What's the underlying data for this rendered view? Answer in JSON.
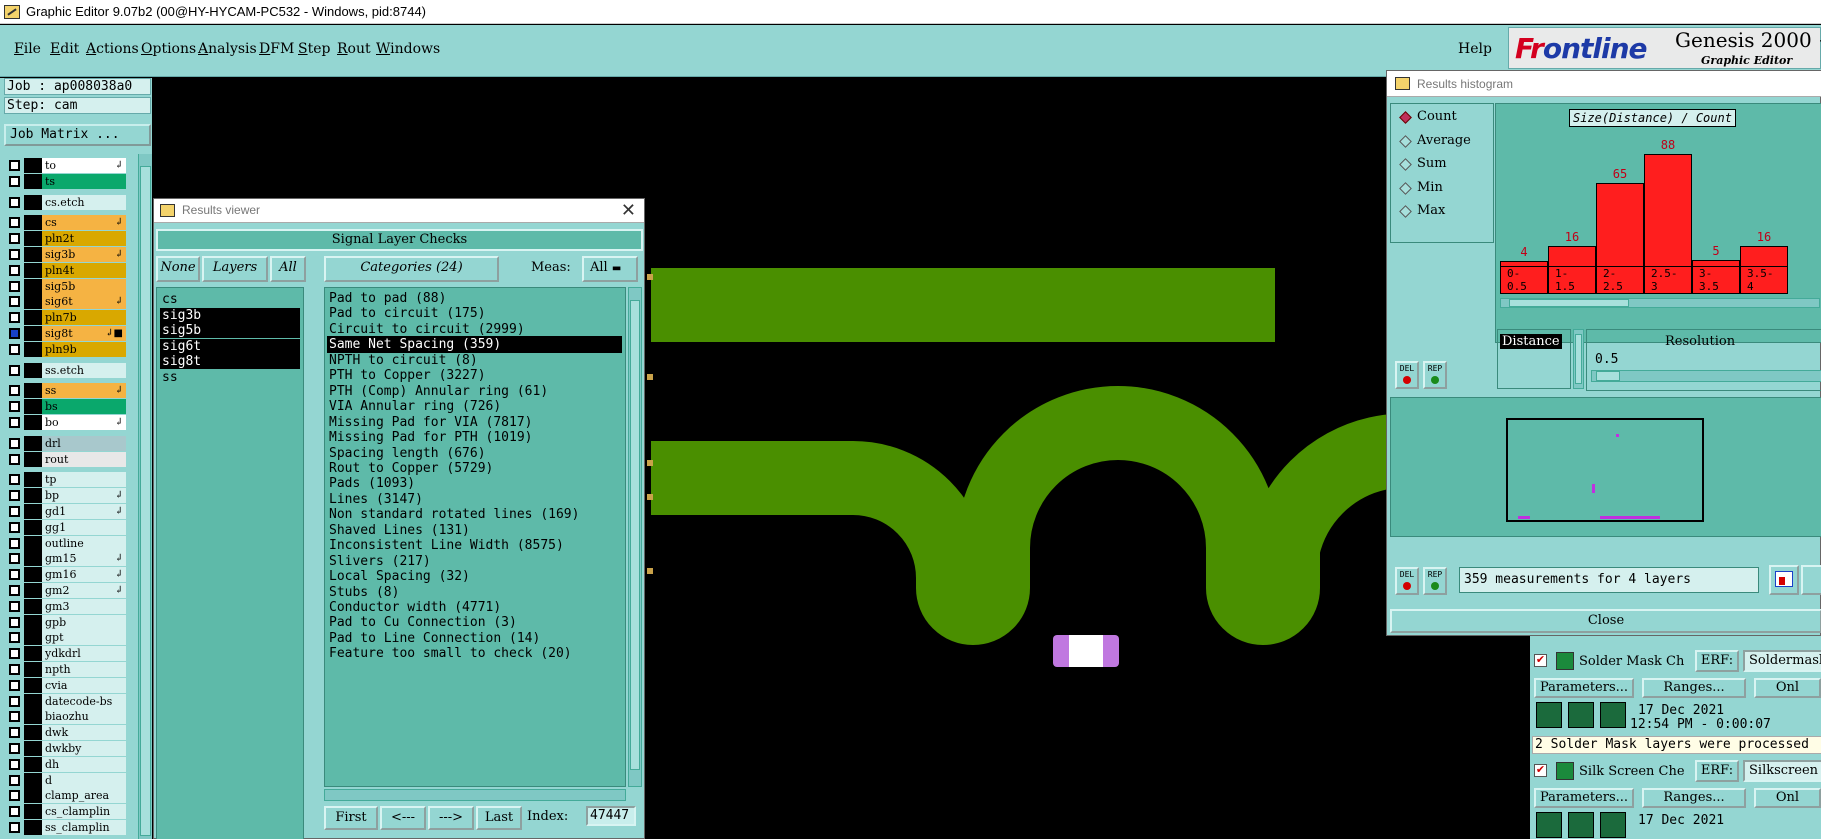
{
  "window": {
    "title": "Graphic Editor 9.07b2 (00@HY-HYCAM-PC532 - Windows, pid:8744)"
  },
  "menu": {
    "items": [
      "File",
      "Edit",
      "Actions",
      "Options",
      "Analysis",
      "DFM",
      "Step",
      "Rout",
      "Windows"
    ],
    "help": "Help"
  },
  "logo": {
    "brand_a": "Fr",
    "brand_b": "ontline",
    "product": "Genesis 2000 +",
    "subtitle": "Graphic Editor"
  },
  "job": {
    "job": "Job : ap008038a0",
    "step": "Step: cam",
    "matrix_button": "Job Matrix ..."
  },
  "layers": [
    {
      "name": "to",
      "color": "#ffffff",
      "arrow": "↲"
    },
    {
      "name": "ts",
      "color": "#0aa86c",
      "arrow": ""
    },
    {
      "name": "cs.etch",
      "color": "#d5f0ee",
      "arrow": ""
    },
    {
      "name": "cs",
      "color": "#f5b343",
      "arrow": "↲"
    },
    {
      "name": "pln2t",
      "color": "#d9a800",
      "arrow": ""
    },
    {
      "name": "sig3b",
      "color": "#f5b343",
      "arrow": "↲"
    },
    {
      "name": "pln4t",
      "color": "#d9a800",
      "arrow": ""
    },
    {
      "name": "sig5b",
      "color": "#f5b343",
      "arrow": ""
    },
    {
      "name": "sig6t",
      "color": "#f5b343",
      "arrow": "↲"
    },
    {
      "name": "pln7b",
      "color": "#d9a800",
      "arrow": ""
    },
    {
      "name": "sig8t",
      "color": "#f5b343",
      "arrow": "↲■"
    },
    {
      "name": "pln9b",
      "color": "#d9a800",
      "arrow": ""
    },
    {
      "name": "ss.etch",
      "color": "#d5f0ee",
      "arrow": ""
    },
    {
      "name": "ss",
      "color": "#f5b343",
      "arrow": "↲"
    },
    {
      "name": "bs",
      "color": "#0aa86c",
      "arrow": ""
    },
    {
      "name": "bo",
      "color": "#ffffff",
      "arrow": "↲"
    },
    {
      "name": "drl",
      "color": "#a8c8cc",
      "arrow": ""
    },
    {
      "name": "rout",
      "color": "#e8e8e8",
      "arrow": ""
    },
    {
      "name": "tp",
      "color": "#d5f0ee",
      "arrow": ""
    },
    {
      "name": "bp",
      "color": "#d5f0ee",
      "arrow": "↲"
    },
    {
      "name": "gd1",
      "color": "#d5f0ee",
      "arrow": "↲"
    },
    {
      "name": "gg1",
      "color": "#d5f0ee",
      "arrow": ""
    },
    {
      "name": "outline",
      "color": "#d5f0ee",
      "arrow": ""
    },
    {
      "name": "gm15",
      "color": "#d5f0ee",
      "arrow": "↲"
    },
    {
      "name": "gm16",
      "color": "#d5f0ee",
      "arrow": "↲"
    },
    {
      "name": "gm2",
      "color": "#d5f0ee",
      "arrow": "↲"
    },
    {
      "name": "gm3",
      "color": "#d5f0ee",
      "arrow": ""
    },
    {
      "name": "gpb",
      "color": "#d5f0ee",
      "arrow": ""
    },
    {
      "name": "gpt",
      "color": "#d5f0ee",
      "arrow": ""
    },
    {
      "name": "ydkdrl",
      "color": "#d5f0ee",
      "arrow": ""
    },
    {
      "name": "npth",
      "color": "#d5f0ee",
      "arrow": ""
    },
    {
      "name": "cvia",
      "color": "#d5f0ee",
      "arrow": ""
    },
    {
      "name": "datecode-bs",
      "color": "#d5f0ee",
      "arrow": ""
    },
    {
      "name": "biaozhu",
      "color": "#d5f0ee",
      "arrow": ""
    },
    {
      "name": "dwk",
      "color": "#d5f0ee",
      "arrow": ""
    },
    {
      "name": "dwkby",
      "color": "#d5f0ee",
      "arrow": ""
    },
    {
      "name": "dh",
      "color": "#d5f0ee",
      "arrow": ""
    },
    {
      "name": "d",
      "color": "#d5f0ee",
      "arrow": ""
    },
    {
      "name": "clamp_area",
      "color": "#d5f0ee",
      "arrow": ""
    },
    {
      "name": "cs_clamplin",
      "color": "#d5f0ee",
      "arrow": ""
    },
    {
      "name": "ss_clamplin",
      "color": "#d5f0ee",
      "arrow": ""
    }
  ],
  "results_viewer": {
    "title": "Results viewer",
    "group": "Signal Layer Checks",
    "none_btn": "None",
    "layers_btn": "Layers",
    "all_btn": "All",
    "categories_btn": "Categories (24)",
    "meas_label": "Meas:",
    "meas_value": "All",
    "layers": [
      "cs",
      "sig3b",
      "sig5b",
      "sig6t",
      "sig8t",
      "ss"
    ],
    "categories": [
      "Pad to pad (88)",
      "Pad to circuit (175)",
      "Circuit to circuit (2999)",
      "Same Net Spacing (359)",
      "NPTH to circuit (8)",
      "PTH to Copper (3227)",
      "PTH (Comp) Annular ring (61)",
      "VIA Annular ring (726)",
      "Missing Pad for VIA (7817)",
      "Missing Pad for PTH (1019)",
      "Spacing length (676)",
      "Rout to Copper (5729)",
      "Pads (1093)",
      "Lines (3147)",
      "Non standard rotated lines (169)",
      "Shaved Lines (131)",
      "Inconsistent Line Width (8575)",
      "Slivers (217)",
      "Local Spacing (32)",
      "Stubs (8)",
      "Conductor width (4771)",
      "Pad to Cu Connection (3)",
      "Pad to Line Connection (14)",
      "Feature too small to check (20)"
    ],
    "nav": {
      "first": "First",
      "prev": "<---",
      "next": "--->",
      "last": "Last",
      "index_label": "Index:",
      "index_value": "47447"
    }
  },
  "histogram": {
    "title": "Results histogram",
    "options": [
      "Count",
      "Average",
      "Sum",
      "Min",
      "Max"
    ],
    "selected_option": "Count",
    "graph_title": "Size(Distance) / Count",
    "bars": [
      {
        "range": "0-\n0.5",
        "count": "4",
        "value": 4
      },
      {
        "range": "1-\n1.5",
        "count": "16",
        "value": 16
      },
      {
        "range": "2-\n2.5",
        "count": "65",
        "value": 65
      },
      {
        "range": "2.5-\n3",
        "count": "88",
        "value": 88
      },
      {
        "range": "3-\n3.5",
        "count": "5",
        "value": 5
      },
      {
        "range": "3.5-\n4",
        "count": "16",
        "value": 16
      }
    ],
    "distance_label": "Distance",
    "resolution_label": "Resolution",
    "resolution_value": "0.5",
    "del": "DEL",
    "rep": "REP",
    "message": "359 measurements for 4 layers",
    "close": "Close"
  },
  "checks": [
    {
      "name": "Solder Mask Ch",
      "erf": "ERF:",
      "erf_value": "Soldermask",
      "params": "Parameters...",
      "ranges": "Ranges...",
      "onl": "Onl",
      "date": "17 Dec 2021",
      "time": "12:54 PM - 0:00:07"
    },
    {
      "name": "Silk Screen Che",
      "erf": "ERF:",
      "erf_value": "Silkscreen",
      "params": "Parameters...",
      "ranges": "Ranges...",
      "onl": "Onl",
      "date": "17 Dec 2021",
      "time": ""
    }
  ],
  "checks_message": "2 Solder Mask layers were processed"
}
